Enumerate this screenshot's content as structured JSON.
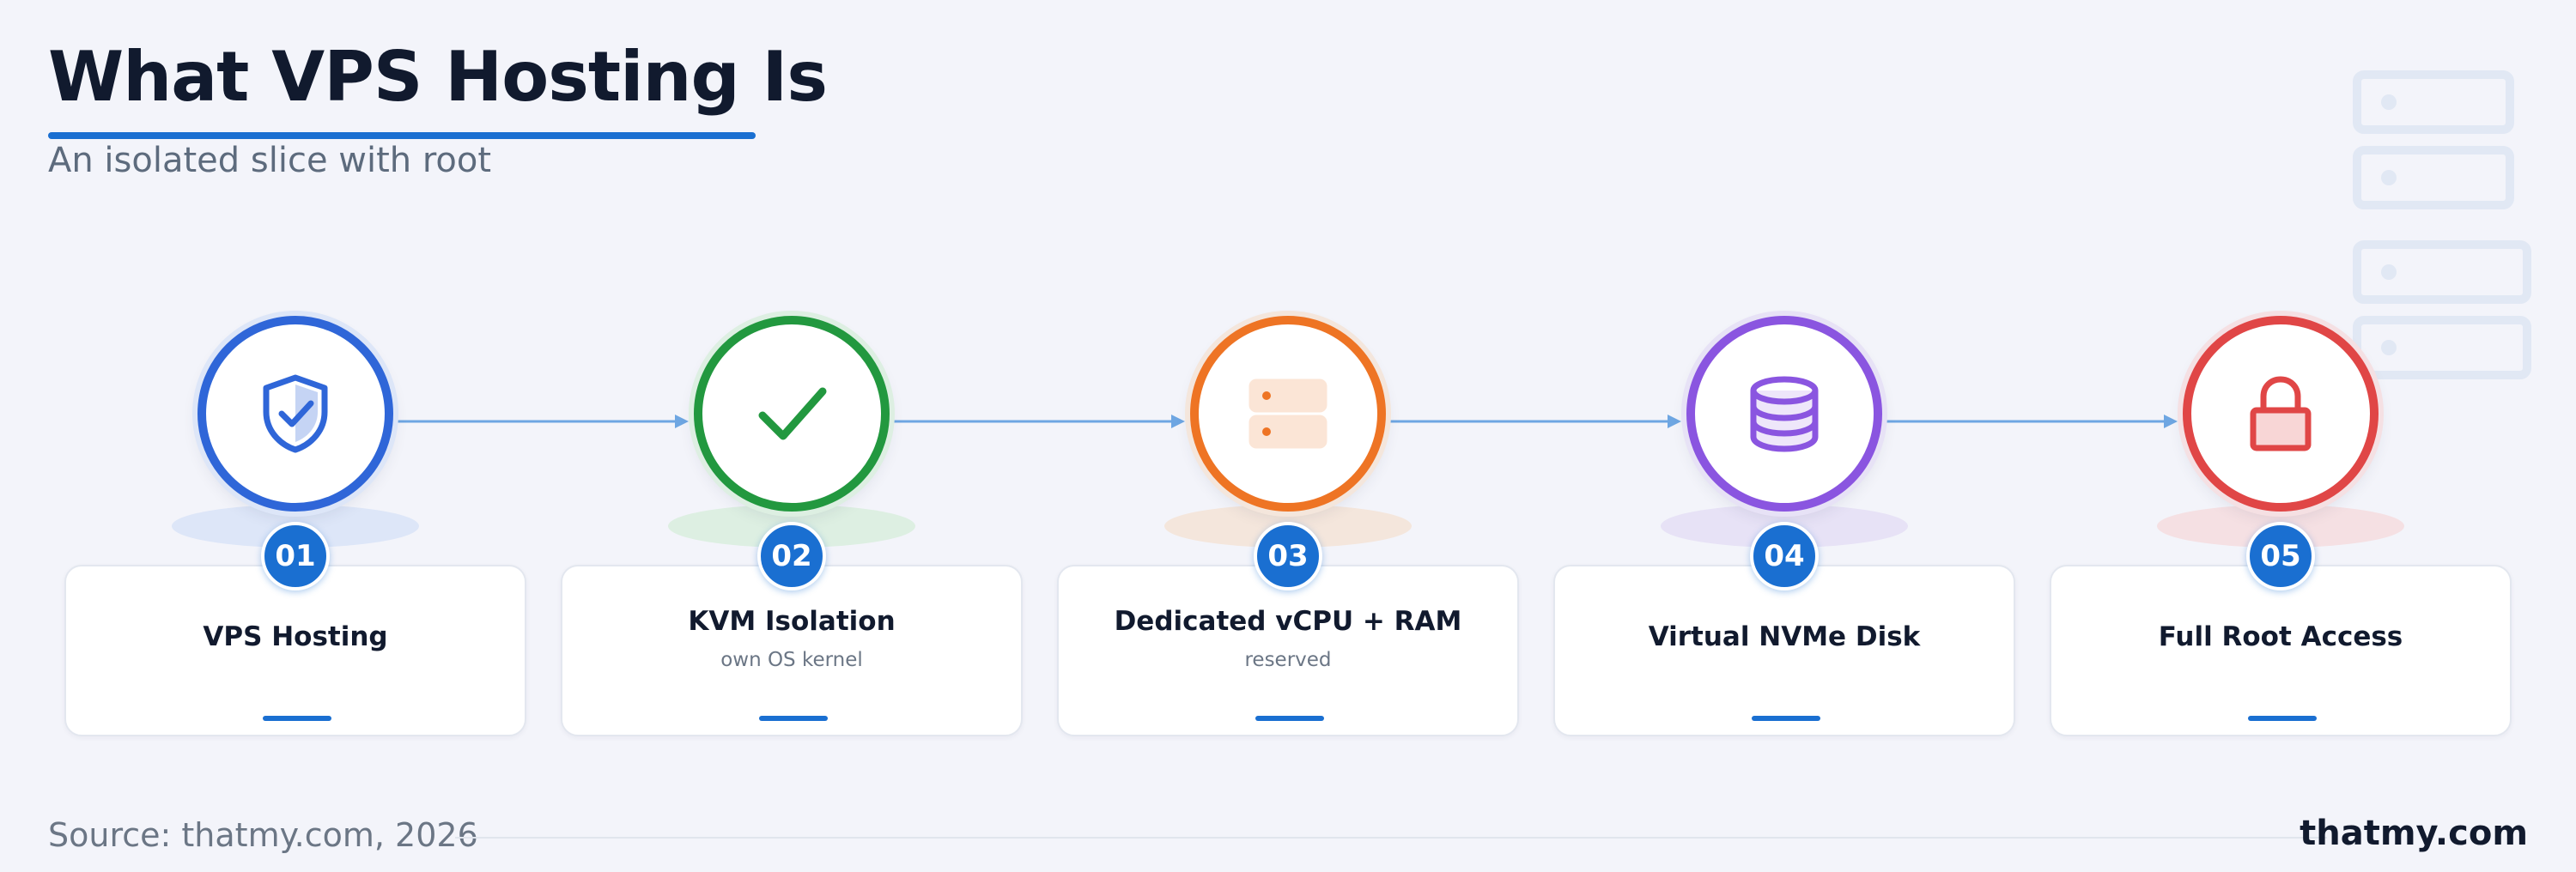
{
  "header": {
    "title": "What VPS Hosting Is",
    "subtitle": "An isolated slice with root"
  },
  "steps": [
    {
      "number": "01",
      "title": "VPS Hosting",
      "subtitle": "",
      "icon": "shield-check-icon",
      "color": "#2f66d8",
      "glow": "#dde6f8"
    },
    {
      "number": "02",
      "title": "KVM Isolation",
      "subtitle": "own OS kernel",
      "icon": "checkmark-icon",
      "color": "#22983f",
      "glow": "#ddefe2"
    },
    {
      "number": "03",
      "title": "Dedicated vCPU + RAM",
      "subtitle": "reserved",
      "icon": "server-icon",
      "color": "#ee7424",
      "glow": "#f4e6dc"
    },
    {
      "number": "04",
      "title": "Virtual NVMe Disk",
      "subtitle": "",
      "icon": "database-icon",
      "color": "#8a55e0",
      "glow": "#e7e2f6"
    },
    {
      "number": "05",
      "title": "Full Root Access",
      "subtitle": "",
      "icon": "lock-icon",
      "color": "#e04646",
      "glow": "#f5e0e3"
    }
  ],
  "accent_color": "#1a6fd1",
  "connector_color": "#6ea6e2",
  "footer": {
    "source": "Source: thatmy.com, 2026",
    "brand": "thatmy.com"
  }
}
